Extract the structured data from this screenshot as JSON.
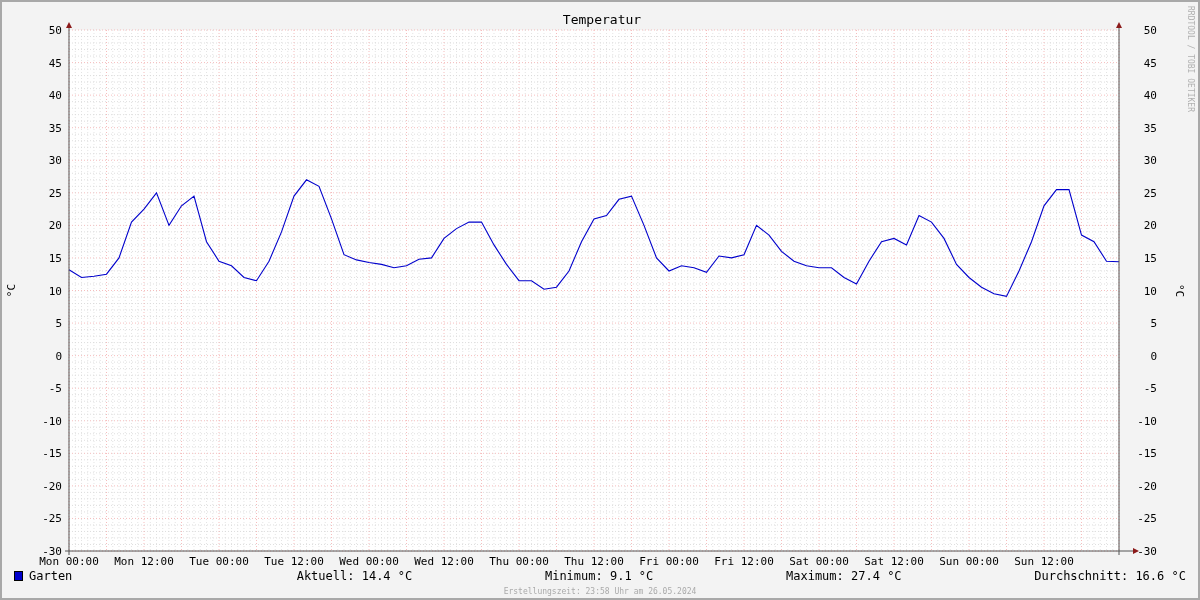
{
  "side_label": "RRDTOOL / TOBI OETIKER",
  "chart_data": {
    "type": "line",
    "title": "Temperatur",
    "ylabel": "°C",
    "categories": [
      "Mon 00:00",
      null,
      null,
      null,
      null,
      null,
      "Mon 12:00",
      null,
      null,
      null,
      null,
      null,
      "Tue 00:00",
      null,
      null,
      null,
      null,
      null,
      "Tue 12:00",
      null,
      null,
      null,
      null,
      null,
      "Wed 00:00",
      null,
      null,
      null,
      null,
      null,
      "Wed 12:00",
      null,
      null,
      null,
      null,
      null,
      "Thu 00:00",
      null,
      null,
      null,
      null,
      null,
      "Thu 12:00",
      null,
      null,
      null,
      null,
      null,
      "Fri 00:00",
      null,
      null,
      null,
      null,
      null,
      "Fri 12:00",
      null,
      null,
      null,
      null,
      null,
      "Sat 00:00",
      null,
      null,
      null,
      null,
      null,
      "Sat 12:00",
      null,
      null,
      null,
      null,
      null,
      "Sun 00:00",
      null,
      null,
      null,
      null,
      null,
      "Sun 12:00",
      null,
      null,
      null,
      null,
      null,
      null
    ],
    "series": [
      {
        "name": "Garten",
        "color": "#0000cc",
        "values": [
          13.2,
          12.0,
          12.2,
          12.5,
          15,
          20.5,
          22.5,
          25,
          20,
          23,
          24.5,
          17.5,
          14.5,
          13.8,
          12,
          11.5,
          14.5,
          19,
          24.5,
          27,
          26,
          21,
          15.5,
          14.7,
          14.3,
          14,
          13.5,
          13.8,
          14.8,
          15,
          18,
          19.5,
          20.5,
          20.5,
          17,
          14,
          11.5,
          11.5,
          10.2,
          10.5,
          13,
          17.5,
          21,
          21.5,
          24,
          24.5,
          20,
          15,
          13,
          13.8,
          13.5,
          12.8,
          15.3,
          15,
          15.5,
          20,
          18.5,
          16,
          14.5,
          13.8,
          13.5,
          13.5,
          12,
          11,
          14.5,
          17.5,
          18,
          17,
          21.5,
          20.5,
          18,
          14,
          12,
          10.5,
          9.5,
          9.1,
          13,
          17.5,
          23,
          25.5,
          25.5,
          18.5,
          17.5,
          14.5,
          14.4
        ]
      }
    ],
    "ylim": [
      -30,
      50
    ],
    "grid": true,
    "yticks": [
      -30,
      -25,
      -20,
      -15,
      -10,
      -5,
      0,
      5,
      10,
      15,
      20,
      25,
      30,
      35,
      40,
      45,
      50
    ]
  },
  "right_axis": {
    "label": "°C",
    "ticks": [
      "50",
      "45",
      "40",
      "35",
      "30",
      "25",
      "20",
      "15",
      "10",
      "5",
      "0",
      "-5",
      "-10",
      "-15",
      "-20",
      "-25",
      "-30"
    ]
  },
  "stats": [
    "Aktuell: 14.4 °C",
    "Minimum: 9.1 °C",
    "Maximum: 27.4 °C",
    "Durchschnitt: 16.6 °C"
  ],
  "footer": "Erstellungszeit: 23:58 Uhr am 26.05.2024"
}
